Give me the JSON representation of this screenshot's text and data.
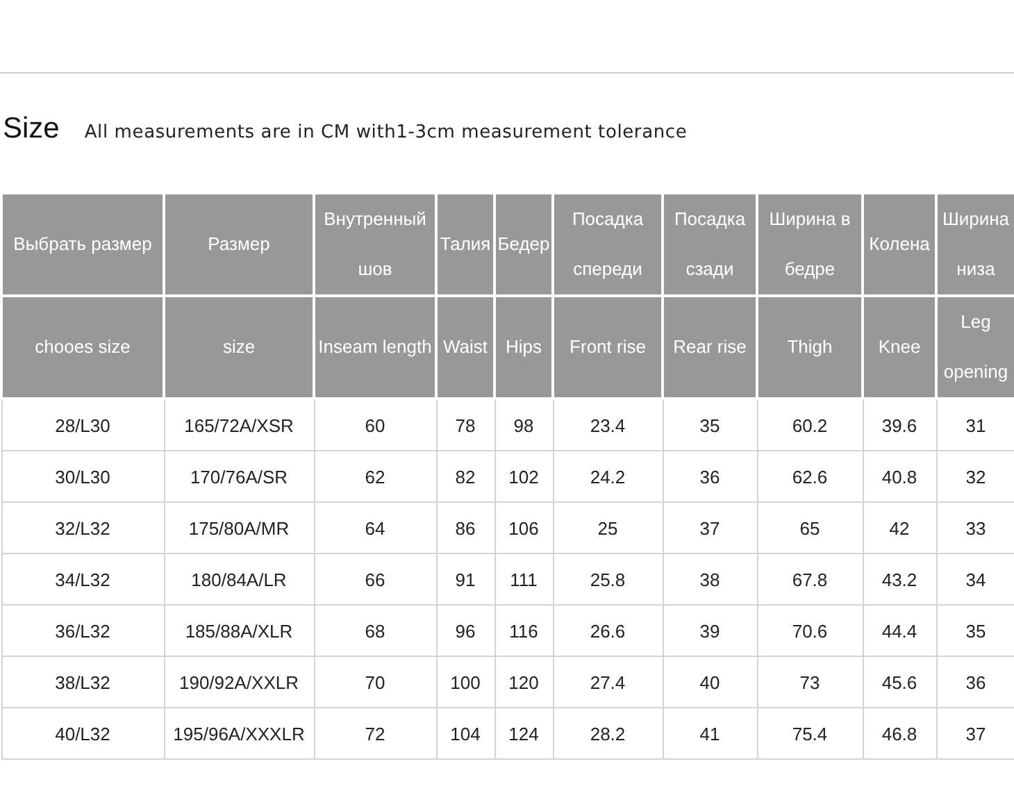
{
  "heading": {
    "title": "Size",
    "note": "All measurements are in CM with1-3cm measurement tolerance"
  },
  "table": {
    "header_rows": [
      [
        "Выбрать размер",
        "Размер",
        "Внутренный шов",
        "Талия",
        "Бедер",
        "Посадка спереди",
        "Посадка сзади",
        "Ширина в бедре",
        "Колена",
        "Ширина низа"
      ],
      [
        "chooes size",
        "size",
        "Inseam length",
        "Waist",
        "Hips",
        "Front rise",
        "Rear rise",
        "Thigh",
        "Knee",
        "Leg opening"
      ]
    ],
    "rows": [
      [
        "28/L30",
        "165/72A/XSR",
        "60",
        "78",
        "98",
        "23.4",
        "35",
        "60.2",
        "39.6",
        "31"
      ],
      [
        "30/L30",
        "170/76A/SR",
        "62",
        "82",
        "102",
        "24.2",
        "36",
        "62.6",
        "40.8",
        "32"
      ],
      [
        "32/L32",
        "175/80A/MR",
        "64",
        "86",
        "106",
        "25",
        "37",
        "65",
        "42",
        "33"
      ],
      [
        "34/L32",
        "180/84A/LR",
        "66",
        "91",
        "111",
        "25.8",
        "38",
        "67.8",
        "43.2",
        "34"
      ],
      [
        "36/L32",
        "185/88A/XLR",
        "68",
        "96",
        "116",
        "26.6",
        "39",
        "70.6",
        "44.4",
        "35"
      ],
      [
        "38/L32",
        "190/92A/XXLR",
        "70",
        "100",
        "120",
        "27.4",
        "40",
        "73",
        "45.6",
        "36"
      ],
      [
        "40/L32",
        "195/96A/XXXLR",
        "72",
        "104",
        "124",
        "28.2",
        "41",
        "75.4",
        "46.8",
        "37"
      ]
    ]
  }
}
